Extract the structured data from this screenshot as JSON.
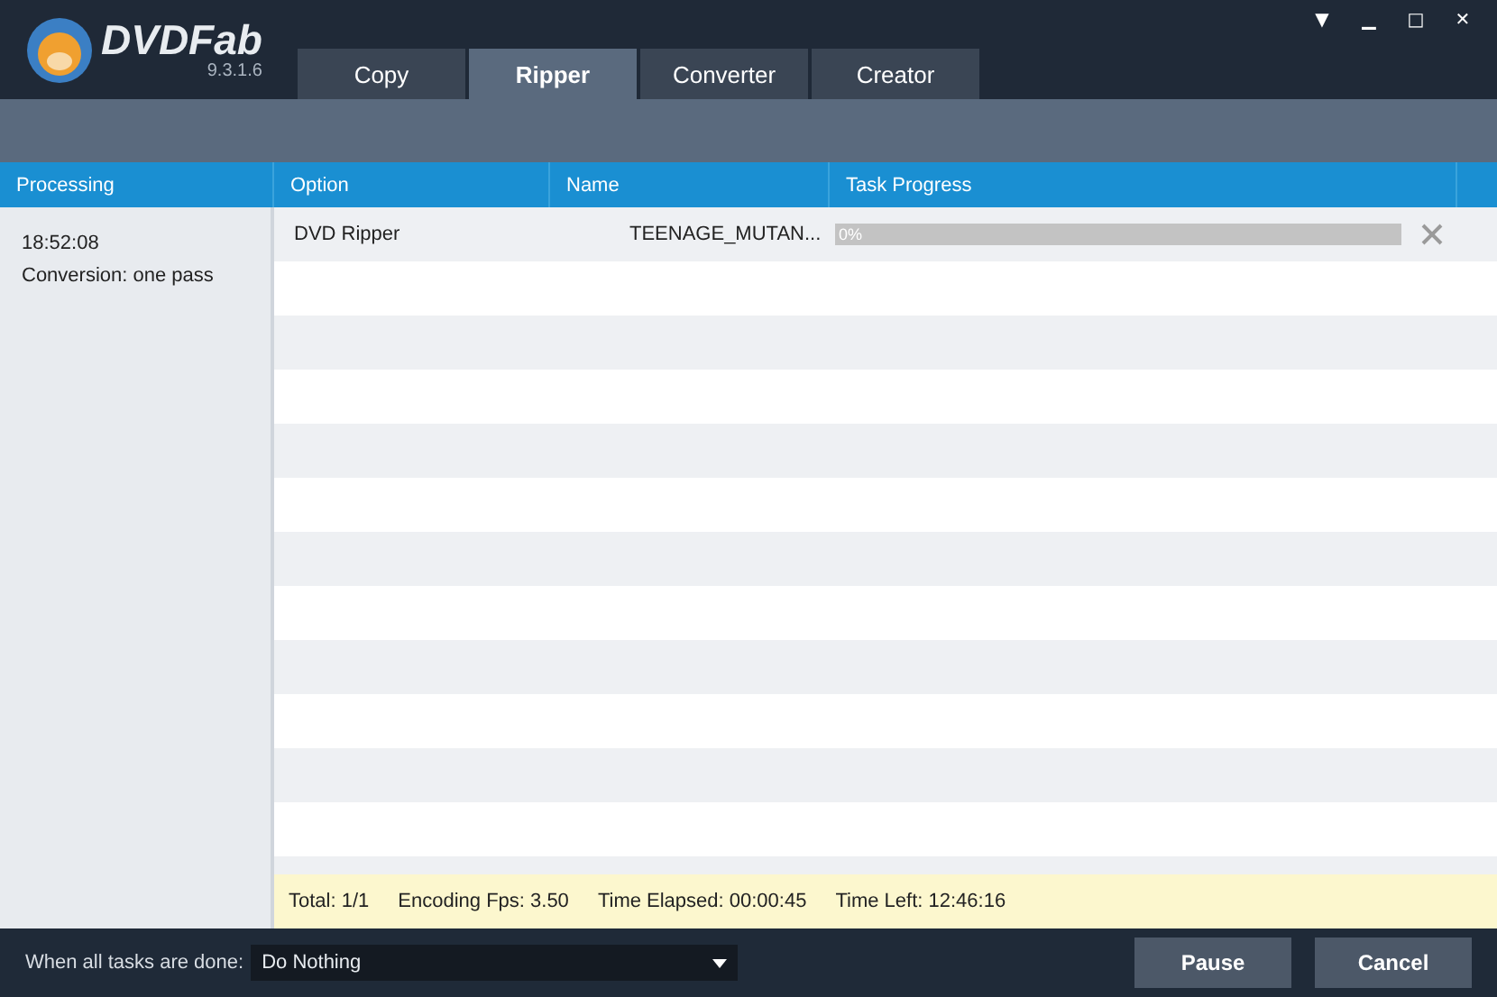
{
  "app": {
    "name": "DVDFab",
    "version": "9.3.1.6"
  },
  "window_controls": [
    "▼",
    "▁",
    "□",
    "✕"
  ],
  "tabs": [
    {
      "label": "Copy",
      "selected": false
    },
    {
      "label": "Ripper",
      "selected": true
    },
    {
      "label": "Converter",
      "selected": false
    },
    {
      "label": "Creator",
      "selected": false
    }
  ],
  "processing": {
    "heading": "Processing",
    "time": "18:52:08",
    "detail": "Conversion: one pass"
  },
  "table": {
    "columns": [
      "Option",
      "Name",
      "Task Progress"
    ],
    "rows": [
      {
        "option": "DVD Ripper",
        "name": "TEENAGE_MUTAN...",
        "level": 0,
        "progress_text": "0%"
      }
    ]
  },
  "status_bar": [
    "Total: 1/1",
    "Encoding Fps: 3.50",
    "Time Elapsed: 00:00:45",
    "Time Left: 12:46:16"
  ],
  "footer": {
    "label": "When all tasks are done:",
    "dropdown_value": "Do Nothing",
    "buttons": [
      "Pause",
      "Cancel"
    ]
  }
}
